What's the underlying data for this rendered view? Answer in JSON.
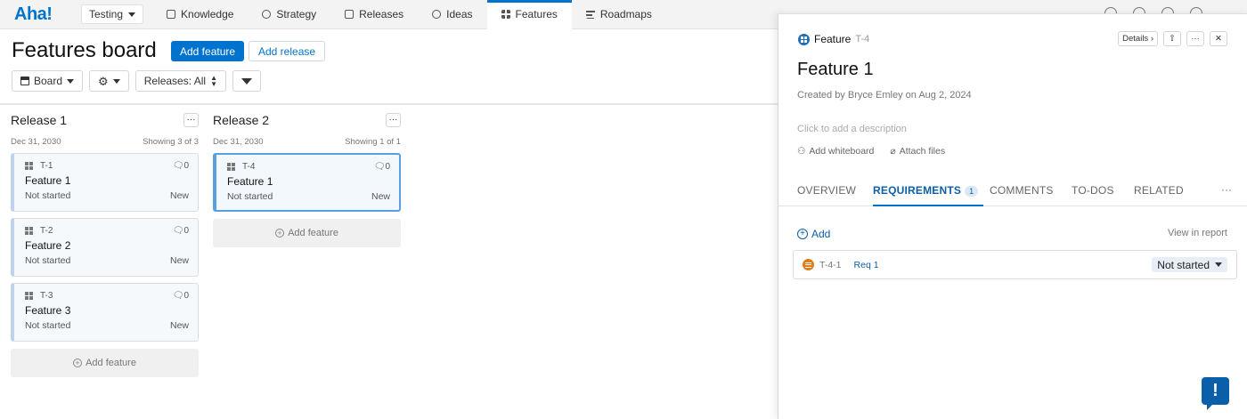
{
  "app": {
    "logo": "Aha!",
    "workspace": "Testing"
  },
  "nav": {
    "tabs": [
      "Knowledge",
      "Strategy",
      "Releases",
      "Ideas",
      "Features",
      "Roadmaps"
    ]
  },
  "board": {
    "title": "Features board",
    "add_feature_label": "Add feature",
    "add_release_label": "Add release",
    "view_label": "Board",
    "releases_filter": "Releases: All",
    "columns": [
      {
        "title": "Release 1",
        "date": "Dec 31, 2030",
        "showing": "Showing 3 of 3",
        "cards": [
          {
            "key": "T-1",
            "name": "Feature 1",
            "status": "Not started",
            "label": "New",
            "comments": "0"
          },
          {
            "key": "T-2",
            "name": "Feature 2",
            "status": "Not started",
            "label": "New",
            "comments": "0"
          },
          {
            "key": "T-3",
            "name": "Feature 3",
            "status": "Not started",
            "label": "New",
            "comments": "0"
          }
        ],
        "add_label": "Add feature"
      },
      {
        "title": "Release 2",
        "date": "Dec 31, 2030",
        "showing": "Showing 1 of 1",
        "cards": [
          {
            "key": "T-4",
            "name": "Feature 1",
            "status": "Not started",
            "label": "New",
            "comments": "0"
          }
        ],
        "add_label": "Add feature"
      }
    ]
  },
  "drawer": {
    "type": "Feature",
    "key": "T-4",
    "details_label": "Details",
    "title": "Feature 1",
    "created": "Created by Bryce Emley on Aug 2, 2024",
    "description_placeholder": "Click to add a description",
    "add_whiteboard": "Add whiteboard",
    "attach_files": "Attach files",
    "tabs": {
      "overview": "OVERVIEW",
      "requirements": "REQUIREMENTS",
      "requirements_count": "1",
      "comments": "COMMENTS",
      "todos": "TO-DOS",
      "related": "RELATED"
    },
    "add_label": "Add",
    "view_in_report": "View in report",
    "requirement": {
      "key": "T-4-1",
      "name": "Req 1",
      "status": "Not started"
    }
  },
  "colors": {
    "accent": "#0073cf",
    "requirement_icon": "#e07e1b"
  }
}
